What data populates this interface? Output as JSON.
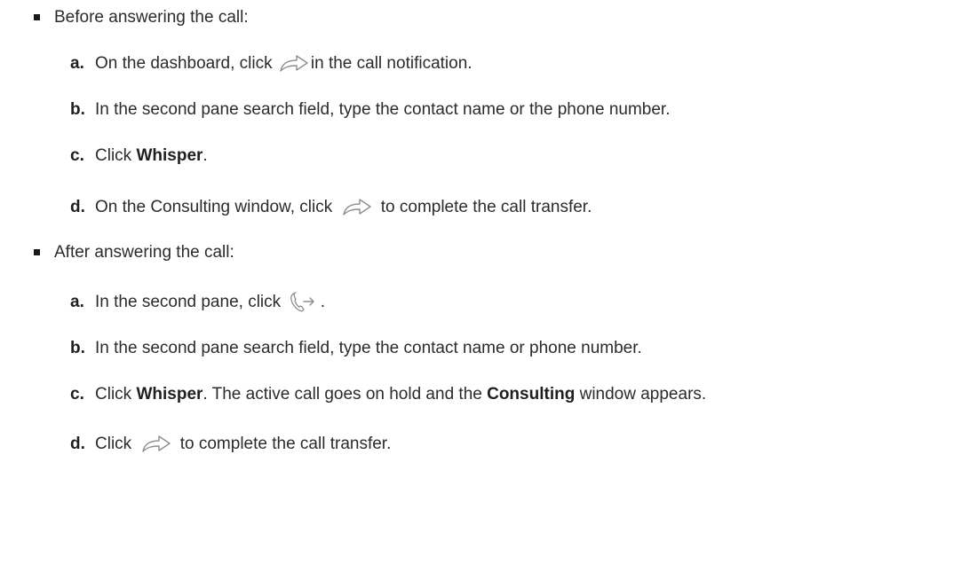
{
  "section_before": {
    "title": "Before answering the call:",
    "steps": [
      {
        "letter": "a.",
        "text_before": "On the dashboard, click ",
        "icon": "forward-arrow-icon",
        "text_after": "in the call notification."
      },
      {
        "letter": "b.",
        "text": "In the second pane search field, type the contact name or the phone number."
      },
      {
        "letter": "c.",
        "text_before": "Click ",
        "bold": "Whisper",
        "text_after": "."
      },
      {
        "letter": "d.",
        "text_before": "On the Consulting window, click ",
        "icon": "forward-arrow-icon",
        "text_after": " to complete the call transfer."
      }
    ]
  },
  "section_after": {
    "title": "After answering the call:",
    "steps": [
      {
        "letter": "a.",
        "text_before": "In the second pane, click ",
        "icon": "phone-transfer-icon",
        "text_after": " ."
      },
      {
        "letter": "b.",
        "text": "In the second pane search field, type the contact name or phone number."
      },
      {
        "letter": "c.",
        "text_before": "Click ",
        "bold": "Whisper",
        "text_middle": ". The active call goes on hold and the ",
        "bold2": "Consulting",
        "text_after": " window appears."
      },
      {
        "letter": "d.",
        "text_before": "Click ",
        "icon": "forward-arrow-icon",
        "text_after": " to complete the call transfer."
      }
    ]
  }
}
